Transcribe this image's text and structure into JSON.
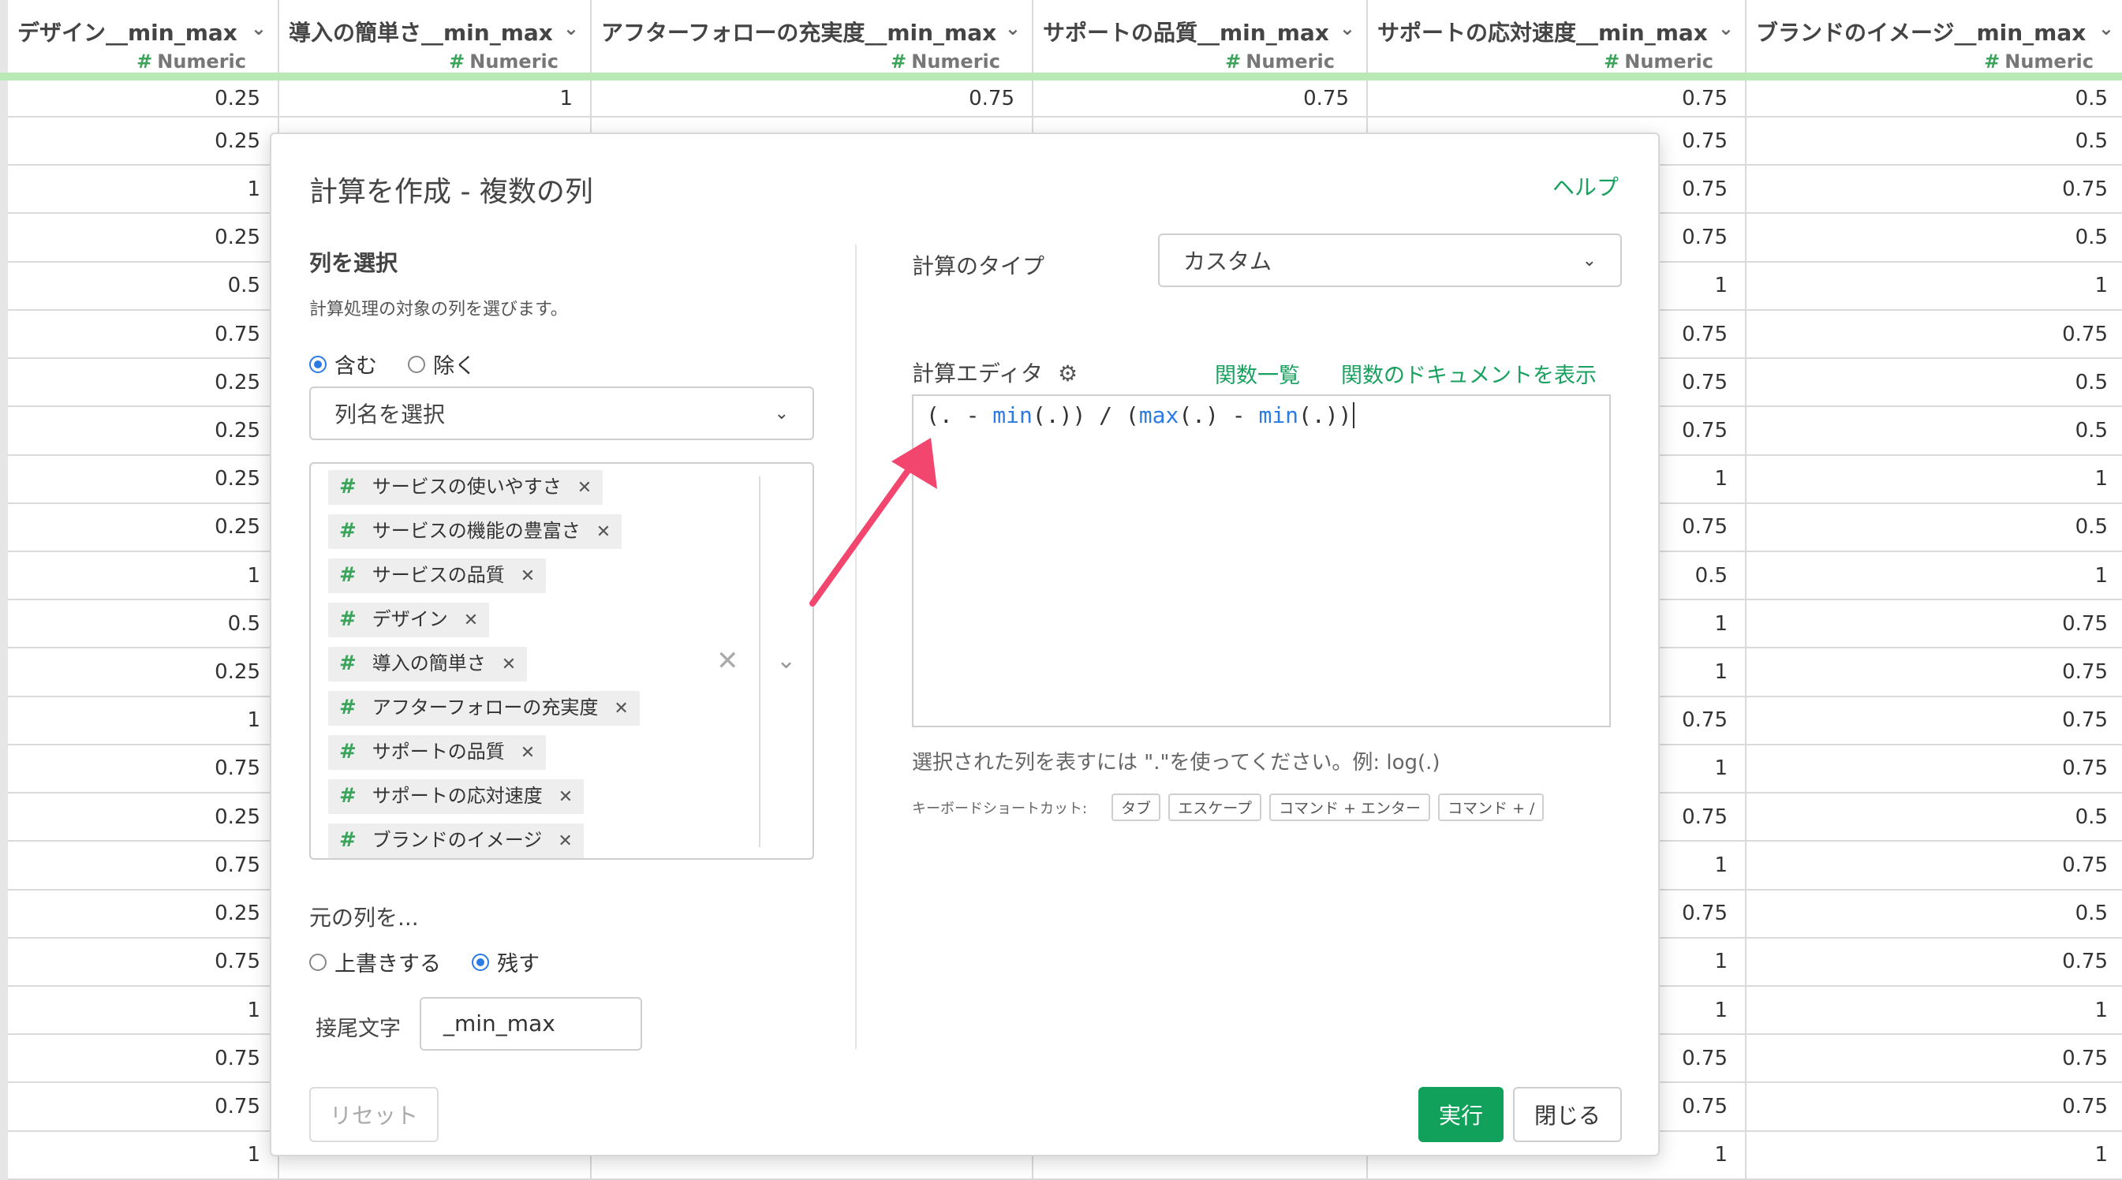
{
  "grid": {
    "columns": [
      {
        "name": "デザイン__min_max",
        "type": "Numeric"
      },
      {
        "name": "導入の簡単さ__min_max",
        "type": "Numeric"
      },
      {
        "name": "アフターフォローの充実度__min_max",
        "type": "Numeric"
      },
      {
        "name": "サポートの品質__min_max",
        "type": "Numeric"
      },
      {
        "name": "サポートの応対速度__min_max",
        "type": "Numeric"
      },
      {
        "name": "ブランドのイメージ__min_max",
        "type": "Numeric"
      }
    ],
    "rows": [
      [
        "0.25",
        "1",
        "0.75",
        "0.75",
        "0.75",
        "0.5"
      ],
      [
        "0.25",
        "",
        "",
        "",
        "0.75",
        "0.5"
      ],
      [
        "1",
        "",
        "",
        "",
        "0.75",
        "0.75"
      ],
      [
        "0.25",
        "",
        "",
        "",
        "0.75",
        "0.5"
      ],
      [
        "0.5",
        "",
        "",
        "",
        "1",
        "1"
      ],
      [
        "0.75",
        "",
        "",
        "",
        "0.75",
        "0.75"
      ],
      [
        "0.25",
        "",
        "",
        "",
        "0.75",
        "0.5"
      ],
      [
        "0.25",
        "",
        "",
        "",
        "0.75",
        "0.5"
      ],
      [
        "0.25",
        "",
        "",
        "",
        "1",
        "1"
      ],
      [
        "0.25",
        "",
        "",
        "",
        "0.75",
        "0.5"
      ],
      [
        "1",
        "",
        "",
        "",
        "0.5",
        "1"
      ],
      [
        "0.5",
        "",
        "",
        "",
        "1",
        "0.75"
      ],
      [
        "0.25",
        "",
        "",
        "",
        "1",
        "0.75"
      ],
      [
        "1",
        "",
        "",
        "",
        "0.75",
        "0.75"
      ],
      [
        "0.75",
        "",
        "",
        "",
        "1",
        "0.75"
      ],
      [
        "0.25",
        "",
        "",
        "",
        "0.75",
        "0.5"
      ],
      [
        "0.75",
        "",
        "",
        "",
        "1",
        "0.75"
      ],
      [
        "0.25",
        "",
        "",
        "",
        "0.75",
        "0.5"
      ],
      [
        "0.75",
        "",
        "",
        "",
        "1",
        "0.75"
      ],
      [
        "1",
        "",
        "",
        "",
        "1",
        "1"
      ],
      [
        "0.75",
        "",
        "",
        "",
        "0.75",
        "0.75"
      ],
      [
        "0.75",
        "",
        "",
        "",
        "0.75",
        "0.75"
      ],
      [
        "1",
        "",
        "",
        "",
        "1",
        "1"
      ]
    ]
  },
  "dialog": {
    "title": "計算を作成 - 複数の列",
    "help": "ヘルプ",
    "select_columns": {
      "heading": "列を選択",
      "description": "計算処理の対象の列を選びます。",
      "include_label": "含む",
      "exclude_label": "除く",
      "mode": "include",
      "placeholder": "列名を選択",
      "selected": [
        "サービスの使いやすさ",
        "サービスの機能の豊富さ",
        "サービスの品質",
        "デザイン",
        "導入の簡単さ",
        "アフターフォローの充実度",
        "サポートの品質",
        "サポートの応対速度",
        "ブランドのイメージ"
      ]
    },
    "original_column": {
      "heading": "元の列を...",
      "overwrite_label": "上書きする",
      "keep_label": "残す",
      "mode": "keep",
      "suffix_label": "接尾文字",
      "suffix_value": "_min_max"
    },
    "calc_type": {
      "label": "計算のタイプ",
      "value": "カスタム"
    },
    "editor": {
      "label": "計算エディタ",
      "functions_link": "関数一覧",
      "docs_link": "関数のドキュメントを表示",
      "formula_parts": {
        "p1": "(. - ",
        "f1": "min",
        "p2": "(.)) / (",
        "f2": "max",
        "p3": "(.) - ",
        "f3": "min",
        "p4": "(.))"
      },
      "hint": "選択された列を表すには \".\"を使ってください。例: log(.)",
      "shortcut_label": "キーボードショートカット:",
      "shortcuts": [
        "タブ",
        "エスケープ",
        "コマンド + エンター",
        "コマンド + /"
      ]
    },
    "buttons": {
      "reset": "リセット",
      "run": "実行",
      "close": "閉じる"
    }
  },
  "colors": {
    "accent_green": "#12a15b",
    "link_green": "#19a15f",
    "annotation_arrow": "#f2466f",
    "header_underline": "#b9e9b4"
  }
}
